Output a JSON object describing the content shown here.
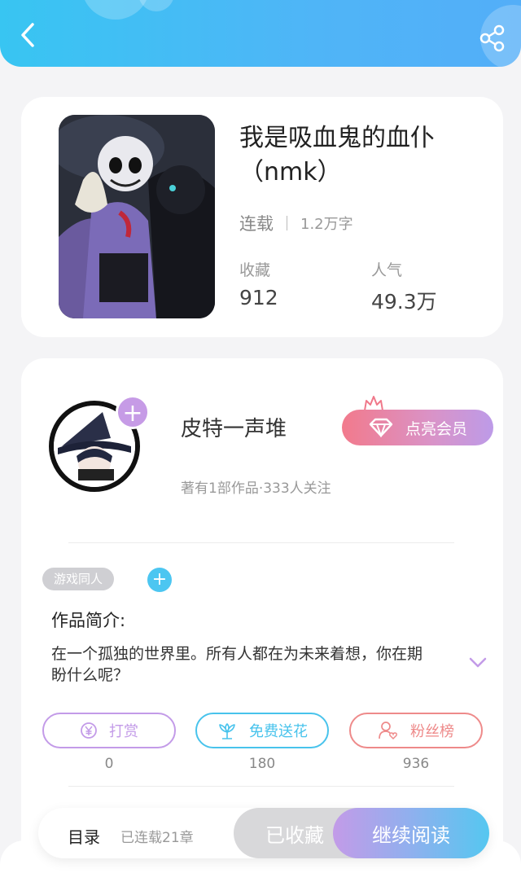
{
  "header": {
    "back_icon": "chevron-left-icon",
    "share_icon": "share-icon",
    "gradient": [
      "#38c5f2",
      "#53aef8"
    ]
  },
  "book": {
    "title": "我是吸血鬼的血仆（nmk）",
    "status": "连载",
    "word_count": "1.2万字",
    "favorites_label": "收藏",
    "favorites_value": "912",
    "popularity_label": "人气",
    "popularity_value": "49.3万"
  },
  "author": {
    "name": "皮特一声堆",
    "meta": "著有1部作品·333人关注",
    "follow_label": "+",
    "vip_button": "点亮会员"
  },
  "tags": [
    {
      "label": "游戏同人"
    }
  ],
  "intro": {
    "heading": "作品简介:",
    "text": "在一个孤独的世界里。所有人都在为未来着想，你在期盼什么呢？"
  },
  "actions": [
    {
      "label": "打赏",
      "icon": "yen-coin-icon",
      "count": "0",
      "color": "#c39be8"
    },
    {
      "label": "免费送花",
      "icon": "flower-icon",
      "count": "180",
      "color": "#48c3ec"
    },
    {
      "label": "粉丝榜",
      "icon": "user-heart-icon",
      "count": "936",
      "color": "#ee8a8a"
    }
  ],
  "bottom_bar": {
    "toc_label": "目录",
    "chapters": "已连载21章",
    "collected_label": "已收藏",
    "read_label": "继续阅读"
  }
}
